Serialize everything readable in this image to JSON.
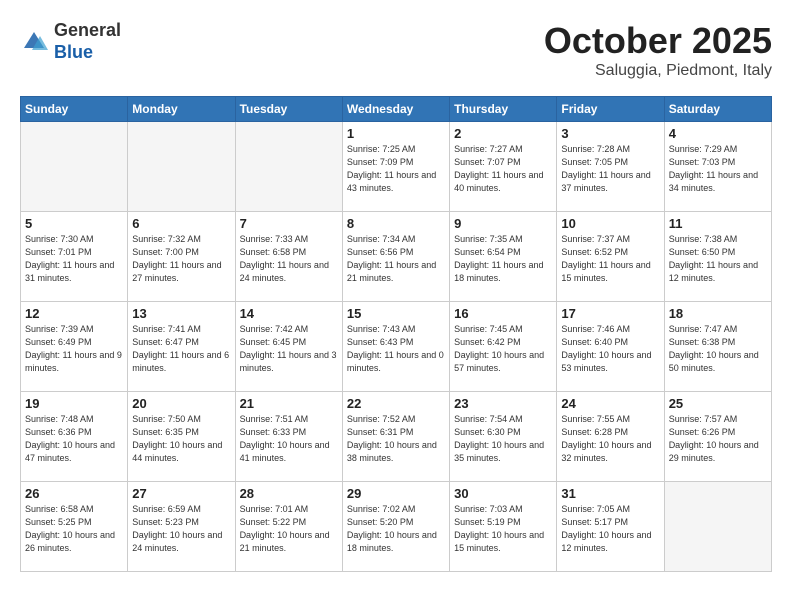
{
  "header": {
    "logo": {
      "general": "General",
      "blue": "Blue"
    },
    "month_title": "October 2025",
    "location": "Saluggia, Piedmont, Italy"
  },
  "weekdays": [
    "Sunday",
    "Monday",
    "Tuesday",
    "Wednesday",
    "Thursday",
    "Friday",
    "Saturday"
  ],
  "weeks": [
    [
      {
        "day": "",
        "info": ""
      },
      {
        "day": "",
        "info": ""
      },
      {
        "day": "",
        "info": ""
      },
      {
        "day": "1",
        "info": "Sunrise: 7:25 AM\nSunset: 7:09 PM\nDaylight: 11 hours\nand 43 minutes."
      },
      {
        "day": "2",
        "info": "Sunrise: 7:27 AM\nSunset: 7:07 PM\nDaylight: 11 hours\nand 40 minutes."
      },
      {
        "day": "3",
        "info": "Sunrise: 7:28 AM\nSunset: 7:05 PM\nDaylight: 11 hours\nand 37 minutes."
      },
      {
        "day": "4",
        "info": "Sunrise: 7:29 AM\nSunset: 7:03 PM\nDaylight: 11 hours\nand 34 minutes."
      }
    ],
    [
      {
        "day": "5",
        "info": "Sunrise: 7:30 AM\nSunset: 7:01 PM\nDaylight: 11 hours\nand 31 minutes."
      },
      {
        "day": "6",
        "info": "Sunrise: 7:32 AM\nSunset: 7:00 PM\nDaylight: 11 hours\nand 27 minutes."
      },
      {
        "day": "7",
        "info": "Sunrise: 7:33 AM\nSunset: 6:58 PM\nDaylight: 11 hours\nand 24 minutes."
      },
      {
        "day": "8",
        "info": "Sunrise: 7:34 AM\nSunset: 6:56 PM\nDaylight: 11 hours\nand 21 minutes."
      },
      {
        "day": "9",
        "info": "Sunrise: 7:35 AM\nSunset: 6:54 PM\nDaylight: 11 hours\nand 18 minutes."
      },
      {
        "day": "10",
        "info": "Sunrise: 7:37 AM\nSunset: 6:52 PM\nDaylight: 11 hours\nand 15 minutes."
      },
      {
        "day": "11",
        "info": "Sunrise: 7:38 AM\nSunset: 6:50 PM\nDaylight: 11 hours\nand 12 minutes."
      }
    ],
    [
      {
        "day": "12",
        "info": "Sunrise: 7:39 AM\nSunset: 6:49 PM\nDaylight: 11 hours\nand 9 minutes."
      },
      {
        "day": "13",
        "info": "Sunrise: 7:41 AM\nSunset: 6:47 PM\nDaylight: 11 hours\nand 6 minutes."
      },
      {
        "day": "14",
        "info": "Sunrise: 7:42 AM\nSunset: 6:45 PM\nDaylight: 11 hours\nand 3 minutes."
      },
      {
        "day": "15",
        "info": "Sunrise: 7:43 AM\nSunset: 6:43 PM\nDaylight: 11 hours\nand 0 minutes."
      },
      {
        "day": "16",
        "info": "Sunrise: 7:45 AM\nSunset: 6:42 PM\nDaylight: 10 hours\nand 57 minutes."
      },
      {
        "day": "17",
        "info": "Sunrise: 7:46 AM\nSunset: 6:40 PM\nDaylight: 10 hours\nand 53 minutes."
      },
      {
        "day": "18",
        "info": "Sunrise: 7:47 AM\nSunset: 6:38 PM\nDaylight: 10 hours\nand 50 minutes."
      }
    ],
    [
      {
        "day": "19",
        "info": "Sunrise: 7:48 AM\nSunset: 6:36 PM\nDaylight: 10 hours\nand 47 minutes."
      },
      {
        "day": "20",
        "info": "Sunrise: 7:50 AM\nSunset: 6:35 PM\nDaylight: 10 hours\nand 44 minutes."
      },
      {
        "day": "21",
        "info": "Sunrise: 7:51 AM\nSunset: 6:33 PM\nDaylight: 10 hours\nand 41 minutes."
      },
      {
        "day": "22",
        "info": "Sunrise: 7:52 AM\nSunset: 6:31 PM\nDaylight: 10 hours\nand 38 minutes."
      },
      {
        "day": "23",
        "info": "Sunrise: 7:54 AM\nSunset: 6:30 PM\nDaylight: 10 hours\nand 35 minutes."
      },
      {
        "day": "24",
        "info": "Sunrise: 7:55 AM\nSunset: 6:28 PM\nDaylight: 10 hours\nand 32 minutes."
      },
      {
        "day": "25",
        "info": "Sunrise: 7:57 AM\nSunset: 6:26 PM\nDaylight: 10 hours\nand 29 minutes."
      }
    ],
    [
      {
        "day": "26",
        "info": "Sunrise: 6:58 AM\nSunset: 5:25 PM\nDaylight: 10 hours\nand 26 minutes."
      },
      {
        "day": "27",
        "info": "Sunrise: 6:59 AM\nSunset: 5:23 PM\nDaylight: 10 hours\nand 24 minutes."
      },
      {
        "day": "28",
        "info": "Sunrise: 7:01 AM\nSunset: 5:22 PM\nDaylight: 10 hours\nand 21 minutes."
      },
      {
        "day": "29",
        "info": "Sunrise: 7:02 AM\nSunset: 5:20 PM\nDaylight: 10 hours\nand 18 minutes."
      },
      {
        "day": "30",
        "info": "Sunrise: 7:03 AM\nSunset: 5:19 PM\nDaylight: 10 hours\nand 15 minutes."
      },
      {
        "day": "31",
        "info": "Sunrise: 7:05 AM\nSunset: 5:17 PM\nDaylight: 10 hours\nand 12 minutes."
      },
      {
        "day": "",
        "info": ""
      }
    ]
  ]
}
